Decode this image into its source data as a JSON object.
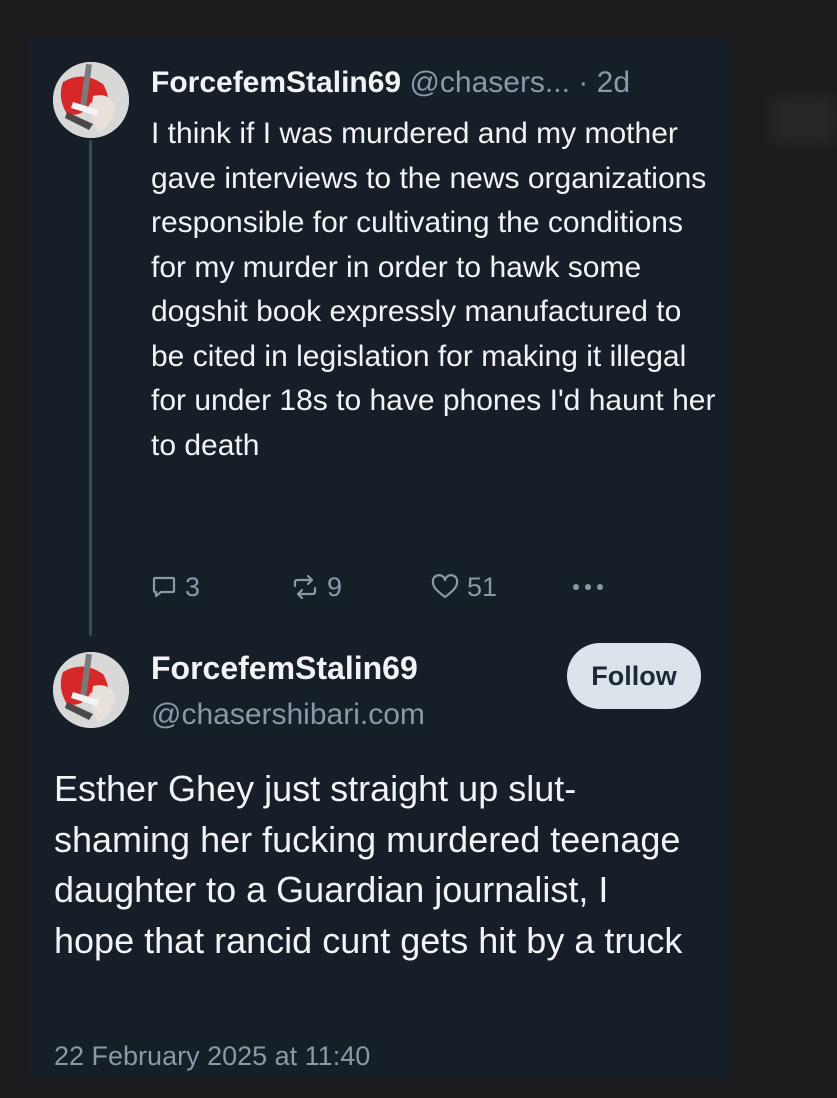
{
  "thread": {
    "parent_post": {
      "display_name": "ForcefemStalin69",
      "handle": "@chasers...",
      "separator": "·",
      "age": "2d",
      "text": "I think if I was murdered and my mother gave interviews to the news organizations responsible for cultivating the conditions for my murder in order to hawk some dogshit book expressly manufactured to be cited in legislation for making it illegal for under 18s to have phones I'd haunt her to death",
      "actions": {
        "reply_count": "3",
        "repost_count": "9",
        "like_count": "51"
      }
    },
    "main_post": {
      "display_name": "ForcefemStalin69",
      "handle": "@chasershibari.com",
      "follow_label": "Follow",
      "text": "Esther Ghey just straight up slut-shaming her fucking murdered teenage daughter to a Guardian journalist, I hope that rancid cunt gets hit by a truck",
      "timestamp": "22 February 2025 at 11:40"
    }
  },
  "icons": [
    "reply-icon",
    "repost-icon",
    "like-icon",
    "more-options-icon"
  ],
  "colors": {
    "page_background": "#1c1c1e",
    "card_background": "#161e27",
    "text_primary": "#f1f3f5",
    "text_muted": "#8b98a8",
    "follow_button_bg": "#dce3ea",
    "avatar_accent": "#d62828"
  }
}
